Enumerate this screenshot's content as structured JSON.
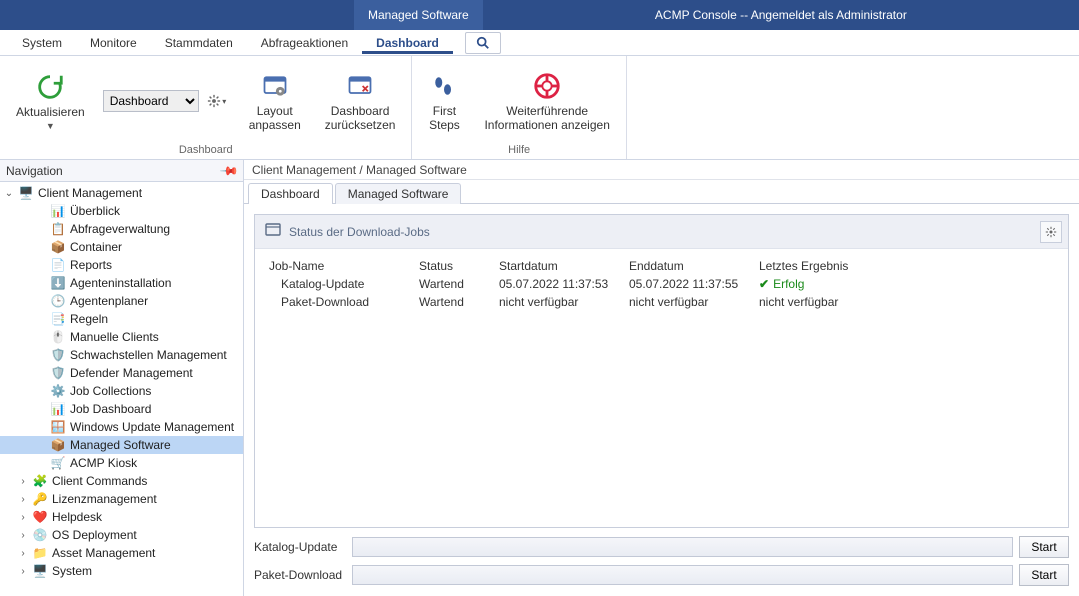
{
  "titlebar": {
    "context_tab": "Managed Software",
    "app_title": "ACMP Console -- Angemeldet als Administrator"
  },
  "menu": {
    "items": [
      "System",
      "Monitore",
      "Stammdaten",
      "Abfrageaktionen",
      "Dashboard"
    ],
    "active_index": 4
  },
  "ribbon": {
    "refresh": "Aktualisieren",
    "dashboard_group_label": "Dashboard",
    "dashboard_select_value": "Dashboard",
    "layout_adjust": "Layout\nanpassen",
    "dashboard_reset": "Dashboard\nzurücksetzen",
    "help_group_label": "Hilfe",
    "first_steps": "First\nSteps",
    "more_info": "Weiterführende\nInformationen anzeigen"
  },
  "nav": {
    "header": "Navigation",
    "tree": {
      "root": "Client Management",
      "children": [
        "Überblick",
        "Abfrageverwaltung",
        "Container",
        "Reports",
        "Agenteninstallation",
        "Agentenplaner",
        "Regeln",
        "Manuelle Clients",
        "Schwachstellen Management",
        "Defender Management",
        "Job Collections",
        "Job Dashboard",
        "Windows Update Management",
        "Managed Software",
        "ACMP Kiosk"
      ],
      "selected_index": 13,
      "siblings": [
        "Client Commands",
        "Lizenzmanagement",
        "Helpdesk",
        "OS Deployment",
        "Asset Management",
        "System"
      ]
    }
  },
  "main": {
    "breadcrumb": "Client Management / Managed Software",
    "tabs": [
      "Dashboard",
      "Managed Software"
    ],
    "active_tab_index": 0,
    "status_panel": {
      "title": "Status der Download-Jobs",
      "columns": [
        "Job-Name",
        "Status",
        "Startdatum",
        "Enddatum",
        "Letztes Ergebnis"
      ],
      "rows": [
        {
          "name": "Katalog-Update",
          "status": "Wartend",
          "start": "05.07.2022 11:37:53",
          "end": "05.07.2022 11:37:55",
          "result": "Erfolg",
          "ok": true
        },
        {
          "name": "Paket-Download",
          "status": "Wartend",
          "start": "nicht verfügbar",
          "end": "nicht verfügbar",
          "result": "nicht verfügbar",
          "ok": false
        }
      ]
    },
    "progress": [
      {
        "label": "Katalog-Update",
        "button": "Start"
      },
      {
        "label": "Paket-Download",
        "button": "Start"
      }
    ]
  }
}
